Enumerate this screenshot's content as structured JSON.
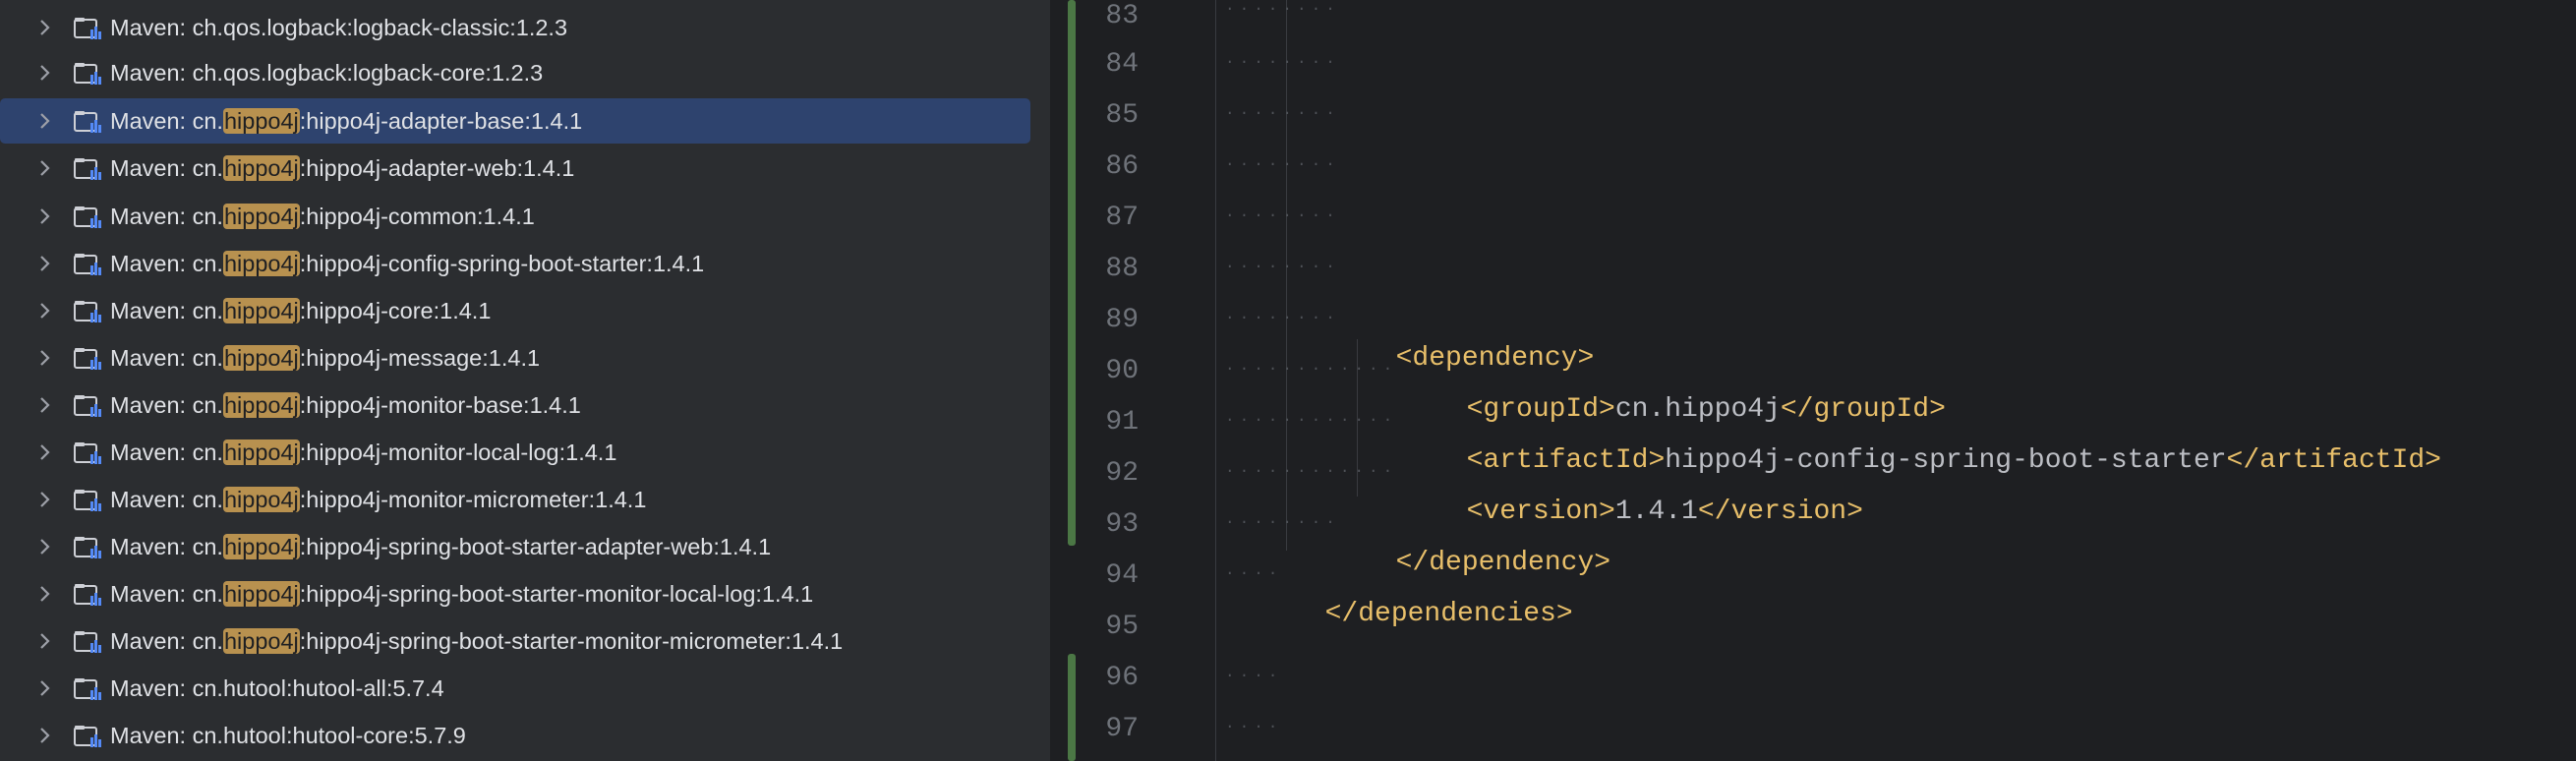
{
  "tree": {
    "items": [
      {
        "prefix": "Maven: ch.qos.logback:logback-classic:1.2.3",
        "match": "",
        "suffix": ""
      },
      {
        "prefix": "Maven: ch.qos.logback:logback-core:1.2.3",
        "match": "",
        "suffix": ""
      },
      {
        "prefix": "Maven: cn.",
        "match": "hippo4j",
        "suffix": ":hippo4j-adapter-base:1.4.1",
        "selected": true
      },
      {
        "prefix": "Maven: cn.",
        "match": "hippo4j",
        "suffix": ":hippo4j-adapter-web:1.4.1"
      },
      {
        "prefix": "Maven: cn.",
        "match": "hippo4j",
        "suffix": ":hippo4j-common:1.4.1"
      },
      {
        "prefix": "Maven: cn.",
        "match": "hippo4j",
        "suffix": ":hippo4j-config-spring-boot-starter:1.4.1"
      },
      {
        "prefix": "Maven: cn.",
        "match": "hippo4j",
        "suffix": ":hippo4j-core:1.4.1"
      },
      {
        "prefix": "Maven: cn.",
        "match": "hippo4j",
        "suffix": ":hippo4j-message:1.4.1"
      },
      {
        "prefix": "Maven: cn.",
        "match": "hippo4j",
        "suffix": ":hippo4j-monitor-base:1.4.1"
      },
      {
        "prefix": "Maven: cn.",
        "match": "hippo4j",
        "suffix": ":hippo4j-monitor-local-log:1.4.1"
      },
      {
        "prefix": "Maven: cn.",
        "match": "hippo4j",
        "suffix": ":hippo4j-monitor-micrometer:1.4.1"
      },
      {
        "prefix": "Maven: cn.",
        "match": "hippo4j",
        "suffix": ":hippo4j-spring-boot-starter-adapter-web:1.4.1"
      },
      {
        "prefix": "Maven: cn.",
        "match": "hippo4j",
        "suffix": ":hippo4j-spring-boot-starter-monitor-local-log:1.4.1"
      },
      {
        "prefix": "Maven: cn.",
        "match": "hippo4j",
        "suffix": ":hippo4j-spring-boot-starter-monitor-micrometer:1.4.1"
      },
      {
        "prefix": "Maven: cn.hutool:hutool-all:5.7.4",
        "match": "",
        "suffix": ""
      },
      {
        "prefix": "Maven: cn.hutool:hutool-core:5.7.9",
        "match": "",
        "suffix": ""
      }
    ]
  },
  "editor": {
    "line_numbers": [
      "83",
      "84",
      "85",
      "86",
      "87",
      "88",
      "89",
      "90",
      "91",
      "92",
      "93",
      "94",
      "95",
      "96",
      "97"
    ],
    "lines": {
      "l89": {
        "open": "<dependency>"
      },
      "l90": {
        "open": "<groupId>",
        "text": "cn.hippo4j",
        "close": "</groupId>"
      },
      "l91": {
        "open": "<artifactId>",
        "text": "hippo4j-config-spring-boot-starter",
        "close": "</artifactId>"
      },
      "l92": {
        "open": "<version>",
        "text": "1.4.1",
        "close": "</version>"
      },
      "l93": {
        "close": "</dependency>"
      },
      "l94": {
        "close": "</dependencies>"
      }
    },
    "colors": {
      "tag": "#e8bf6a",
      "text": "#bcbec4",
      "change_marker": "#4b7745",
      "selection": "#2e436e",
      "search_highlight": "#b8914f"
    }
  }
}
